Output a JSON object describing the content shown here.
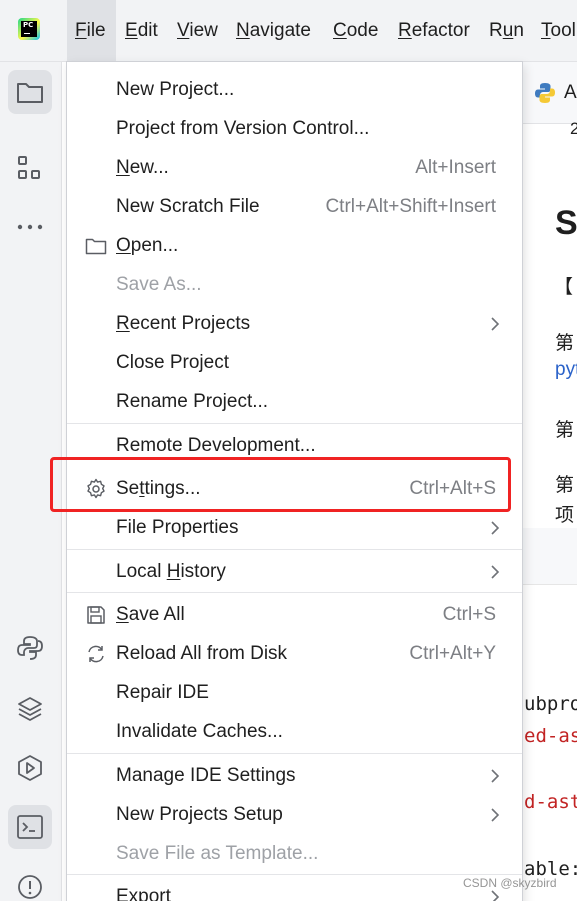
{
  "menubar": {
    "items": [
      {
        "label": "File",
        "mnemonic": "F",
        "rest": "ile"
      },
      {
        "label": "Edit",
        "mnemonic": "E",
        "rest": "dit"
      },
      {
        "label": "View",
        "mnemonic": "V",
        "rest": "iew"
      },
      {
        "label": "Navigate",
        "mnemonic": "N",
        "rest": "avigate"
      },
      {
        "label": "Code",
        "mnemonic": "C",
        "rest": "ode"
      },
      {
        "label": "Refactor",
        "mnemonic": "R",
        "rest": "efactor"
      },
      {
        "label": "Run",
        "mnemonic": "u",
        "pre": "R",
        "rest": "n"
      },
      {
        "label": "Tools",
        "mnemonic": "T",
        "rest": "ool"
      }
    ],
    "logo_text": "PC"
  },
  "file_menu": {
    "items": [
      {
        "label": "New Project...",
        "shortcut": "",
        "submenu": false,
        "disabled": false
      },
      {
        "label": "Project from Version Control...",
        "shortcut": "",
        "submenu": false,
        "disabled": false
      },
      {
        "label": "New...",
        "mnemonic_pre": "",
        "mnemonic": "N",
        "mnemonic_post": "ew...",
        "shortcut": "Alt+Insert",
        "submenu": false,
        "disabled": false
      },
      {
        "label": "New Scratch File",
        "shortcut": "Ctrl+Alt+Shift+Insert",
        "submenu": false,
        "disabled": false
      },
      {
        "label": "Open...",
        "mnemonic_pre": "",
        "mnemonic": "O",
        "mnemonic_post": "pen...",
        "shortcut": "",
        "icon": "folder-icon",
        "submenu": false,
        "disabled": false
      },
      {
        "label": "Save As...",
        "shortcut": "",
        "submenu": false,
        "disabled": true
      },
      {
        "label": "Recent Projects",
        "mnemonic_pre": "",
        "mnemonic": "R",
        "mnemonic_post": "ecent Projects",
        "shortcut": "",
        "submenu": true,
        "disabled": false
      },
      {
        "label": "Close Project",
        "shortcut": "",
        "submenu": false,
        "disabled": false
      },
      {
        "label": "Rename Project...",
        "shortcut": "",
        "submenu": false,
        "disabled": false
      },
      {
        "label": "Remote Development...",
        "shortcut": "",
        "submenu": false,
        "disabled": false
      },
      {
        "label": "Settings...",
        "mnemonic_pre": "Se",
        "mnemonic": "t",
        "mnemonic_post": "tings...",
        "shortcut": "Ctrl+Alt+S",
        "icon": "gear-icon",
        "submenu": false,
        "disabled": false,
        "highlighted": true
      },
      {
        "label": "File Properties",
        "shortcut": "",
        "submenu": true,
        "disabled": false
      },
      {
        "label": "Local History",
        "mnemonic_pre": "Local ",
        "mnemonic": "H",
        "mnemonic_post": "istory",
        "shortcut": "",
        "submenu": true,
        "disabled": false
      },
      {
        "label": "Save All",
        "mnemonic_pre": "",
        "mnemonic": "S",
        "mnemonic_post": "ave All",
        "shortcut": "Ctrl+S",
        "icon": "save-icon",
        "submenu": false,
        "disabled": false
      },
      {
        "label": "Reload All from Disk",
        "shortcut": "Ctrl+Alt+Y",
        "icon": "reload-icon",
        "submenu": false,
        "disabled": false
      },
      {
        "label": "Repair IDE",
        "shortcut": "",
        "submenu": false,
        "disabled": false
      },
      {
        "label": "Invalidate Caches...",
        "shortcut": "",
        "submenu": false,
        "disabled": false
      },
      {
        "label": "Manage IDE Settings",
        "shortcut": "",
        "submenu": true,
        "disabled": false
      },
      {
        "label": "New Projects Setup",
        "shortcut": "",
        "submenu": true,
        "disabled": false
      },
      {
        "label": "Save File as Template...",
        "shortcut": "",
        "submenu": false,
        "disabled": true
      },
      {
        "label": "Export",
        "shortcut": "",
        "submenu": true,
        "disabled": false
      }
    ]
  },
  "background": {
    "tab_label": "A",
    "line_number": "2",
    "heading": "S",
    "bracket_text": "【",
    "para_1": "第",
    "link_text": "pyt",
    "para_2": "第",
    "para_3": "第",
    "para_4": "项",
    "code_lines": [
      "ubpro",
      "ed-as",
      "d-ast",
      "able:"
    ]
  },
  "colors": {
    "highlight_box": "#f02323",
    "code_red": "#c22323",
    "link_blue": "#2a62c9",
    "menu_active": "#dfe1e5"
  },
  "watermark": "CSDN @skyzbird"
}
